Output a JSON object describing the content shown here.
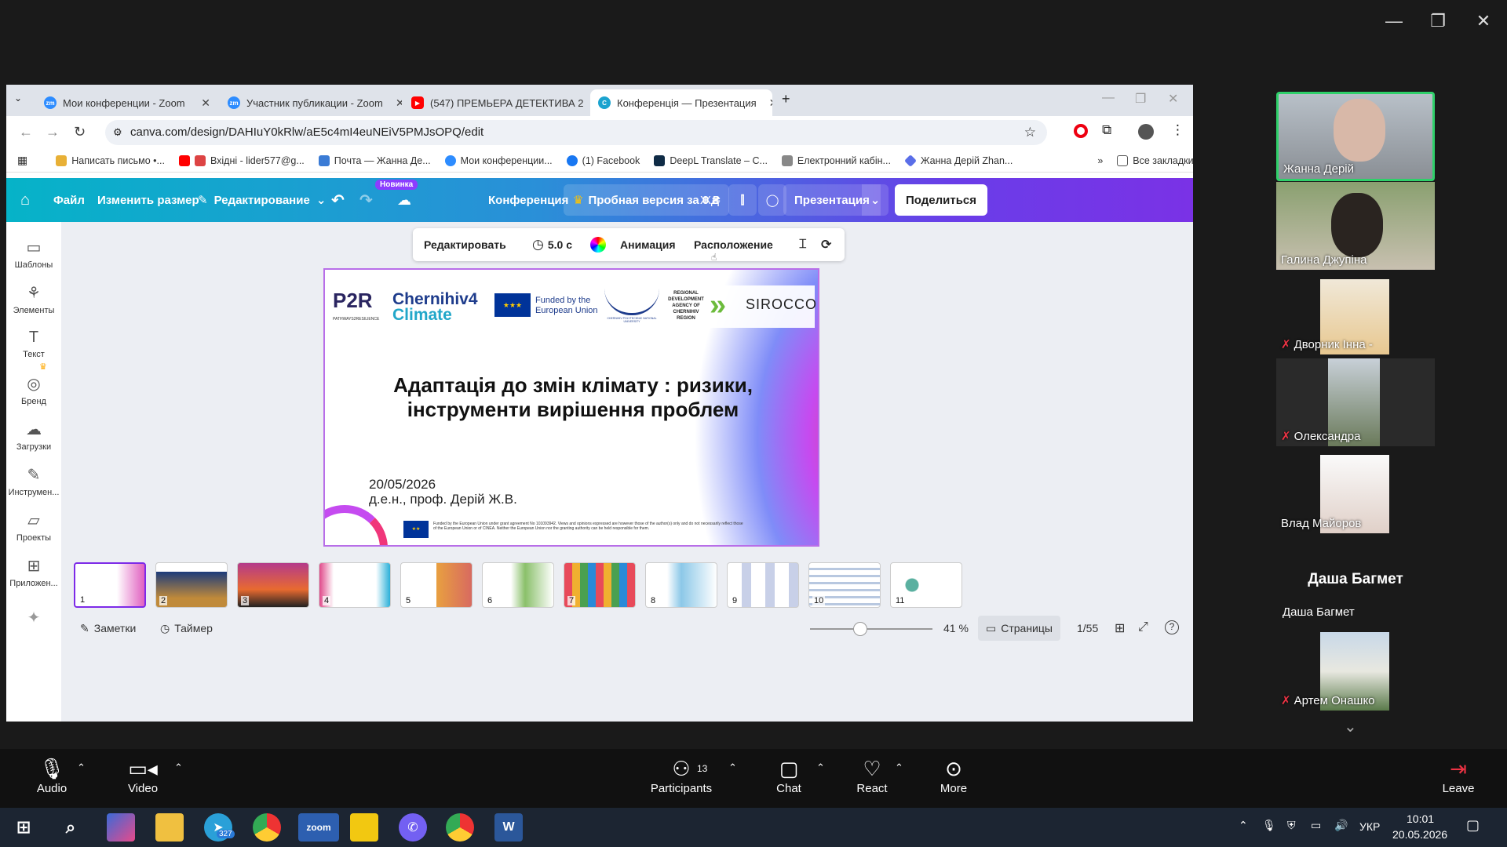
{
  "window_controls": {
    "minimize": "—",
    "restore": "❐",
    "close": "✕"
  },
  "browser": {
    "tabs": [
      {
        "title": "Мои конференции - Zoom",
        "icon": "zoom-icon"
      },
      {
        "title": "Участник публикации - Zoom",
        "icon": "zoom-icon"
      },
      {
        "title": "(547) ПРЕМЬЕРА ДЕТЕКТИВА 2",
        "icon": "youtube-icon"
      },
      {
        "title": "Конференція — Презентация",
        "icon": "canva-icon"
      }
    ],
    "url": "canva.com/design/DAHIuY0kRlw/aE5c4mI4euNEiV5PMJsOPQ/edit",
    "bookmarks": [
      "Написать письмо •...",
      "Вхідні - lider577@g...",
      "Почта — Жанна Де...",
      "Мои конференции...",
      "(1) Facebook",
      "DeepL Translate – C...",
      "Електронний кабін...",
      "Жанна Дерій Zhan..."
    ],
    "all_bookmarks": "Все закладки",
    "colors": {
      "tabbar": "#dfe3ea"
    }
  },
  "canva": {
    "header": {
      "file": "Файл",
      "resize": "Изменить размер",
      "editing": "Редактирование",
      "new_badge": "Новинка",
      "doc_title": "Конференция",
      "trial": "Пробная версия за 0 ₴",
      "user_initials": "ЖД",
      "present": "Презентация",
      "share": "Поделиться"
    },
    "sidebar": [
      {
        "label": "Шаблоны",
        "icon": "templates-icon"
      },
      {
        "label": "Элементы",
        "icon": "elements-icon"
      },
      {
        "label": "Текст",
        "icon": "text-icon"
      },
      {
        "label": "Бренд",
        "icon": "brand-icon"
      },
      {
        "label": "Загрузки",
        "icon": "uploads-icon"
      },
      {
        "label": "Инструмен...",
        "icon": "tools-icon"
      },
      {
        "label": "Проекты",
        "icon": "projects-icon"
      },
      {
        "label": "Приложен...",
        "icon": "apps-icon"
      }
    ],
    "context_toolbar": {
      "edit": "Редактировать",
      "duration": "5.0 с",
      "animation": "Анимация",
      "position": "Расположение"
    },
    "slide": {
      "logo_p2r": "P2R",
      "logo_p2r_sub": "PATHWAYS2RESILIENCE",
      "logo_ch4c_1": "Chernihiv4",
      "logo_ch4c_2": "Climate",
      "eu_funded_1": "Funded by the",
      "eu_funded_2": "European Union",
      "cpnu": "CHERNIHIV POLYTECHNIC NATIONAL UNIVERSITY",
      "rda": "REGIONAL DEVELOPMENT AGENCY OF CHERNIHIV REGION",
      "sirocco": "SIROCCO",
      "title_line1": "Адаптація до змін клімату : ризики,",
      "title_line2": "інструменти вирішення проблем",
      "date": "20/05/2026",
      "author": "д.е.н., проф. Дерій Ж.В.",
      "disclaimer": "Funded by the European Union under grant agreement No 101093942. Views and opinions expressed are however those of the author(s) only and do not necessarily reflect those of the European Union or of CINEA. Neither the European Union nor the granting authority can be held responsible for them."
    },
    "thumbnails": [
      "1",
      "2",
      "3",
      "4",
      "5",
      "6",
      "7",
      "8",
      "9",
      "10",
      "11"
    ],
    "bottom": {
      "notes": "Заметки",
      "timer": "Таймер",
      "zoom": "41 %",
      "zoom_fraction": 0.41,
      "pages": "Страницы",
      "page_count": "1/55"
    }
  },
  "gallery": {
    "participants": [
      {
        "name": "Жанна Дерій",
        "muted": false,
        "active": true
      },
      {
        "name": "Галина Джупіна",
        "muted": false,
        "active": false
      },
      {
        "name": "Дворник Інна -",
        "muted": true,
        "active": false
      },
      {
        "name": "Олександра",
        "muted": true,
        "active": false
      },
      {
        "name": "Влад Майоров",
        "muted": false,
        "active": false
      },
      {
        "name": "Даша Багмет",
        "muted": false,
        "active": false
      },
      {
        "name": "Артем Онашко",
        "muted": true,
        "active": false
      }
    ],
    "big_name": "Даша Багмет"
  },
  "zoom_controls": {
    "audio": "Audio",
    "video": "Video",
    "participants": "Participants",
    "participants_count": "13",
    "chat": "Chat",
    "react": "React",
    "more": "More",
    "leave": "Leave"
  },
  "taskbar": {
    "telegram_badge": "327",
    "lang": "УКР",
    "time": "10:01",
    "date": "20.05.2026"
  }
}
